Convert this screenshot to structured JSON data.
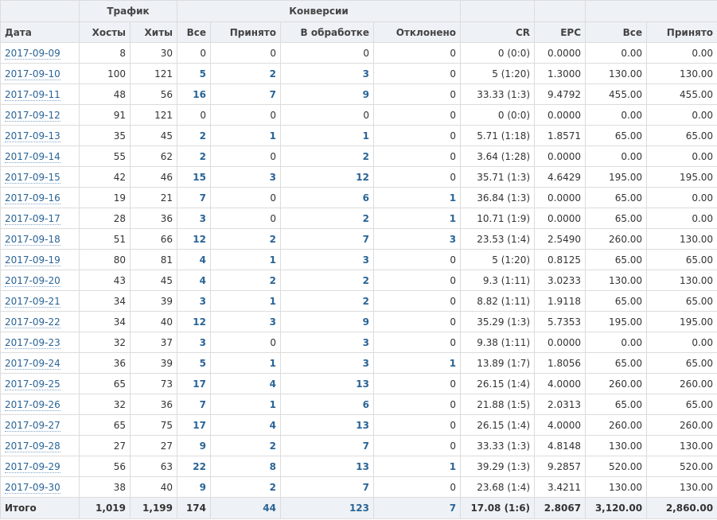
{
  "header": {
    "group_traffic": "Трафик",
    "group_conversions": "Конверсии",
    "col_date": "Дата",
    "col_hosts": "Хосты",
    "col_hits": "Хиты",
    "col_conv_all": "Все",
    "col_conv_accepted": "Принято",
    "col_conv_processing": "В обработке",
    "col_conv_rejected": "Отклонено",
    "col_cr": "CR",
    "col_epc": "EPC",
    "col_money_all": "Все",
    "col_money_accepted": "Принято"
  },
  "rows": [
    {
      "date": "2017-09-09",
      "hosts": "8",
      "hits": "30",
      "all": "0",
      "accepted": "0",
      "processing": "0",
      "rejected": "0",
      "cr": "0 (0:0)",
      "epc": "0.0000",
      "m_all": "0.00",
      "m_accepted": "0.00"
    },
    {
      "date": "2017-09-10",
      "hosts": "100",
      "hits": "121",
      "all": "5",
      "accepted": "2",
      "processing": "3",
      "rejected": "0",
      "cr": "5 (1:20)",
      "epc": "1.3000",
      "m_all": "130.00",
      "m_accepted": "130.00"
    },
    {
      "date": "2017-09-11",
      "hosts": "48",
      "hits": "56",
      "all": "16",
      "accepted": "7",
      "processing": "9",
      "rejected": "0",
      "cr": "33.33 (1:3)",
      "epc": "9.4792",
      "m_all": "455.00",
      "m_accepted": "455.00"
    },
    {
      "date": "2017-09-12",
      "hosts": "91",
      "hits": "121",
      "all": "0",
      "accepted": "0",
      "processing": "0",
      "rejected": "0",
      "cr": "0 (0:0)",
      "epc": "0.0000",
      "m_all": "0.00",
      "m_accepted": "0.00"
    },
    {
      "date": "2017-09-13",
      "hosts": "35",
      "hits": "45",
      "all": "2",
      "accepted": "1",
      "processing": "1",
      "rejected": "0",
      "cr": "5.71 (1:18)",
      "epc": "1.8571",
      "m_all": "65.00",
      "m_accepted": "65.00"
    },
    {
      "date": "2017-09-14",
      "hosts": "55",
      "hits": "62",
      "all": "2",
      "accepted": "0",
      "processing": "2",
      "rejected": "0",
      "cr": "3.64 (1:28)",
      "epc": "0.0000",
      "m_all": "0.00",
      "m_accepted": "0.00"
    },
    {
      "date": "2017-09-15",
      "hosts": "42",
      "hits": "46",
      "all": "15",
      "accepted": "3",
      "processing": "12",
      "rejected": "0",
      "cr": "35.71 (1:3)",
      "epc": "4.6429",
      "m_all": "195.00",
      "m_accepted": "195.00"
    },
    {
      "date": "2017-09-16",
      "hosts": "19",
      "hits": "21",
      "all": "7",
      "accepted": "0",
      "processing": "6",
      "rejected": "1",
      "cr": "36.84 (1:3)",
      "epc": "0.0000",
      "m_all": "65.00",
      "m_accepted": "0.00"
    },
    {
      "date": "2017-09-17",
      "hosts": "28",
      "hits": "36",
      "all": "3",
      "accepted": "0",
      "processing": "2",
      "rejected": "1",
      "cr": "10.71 (1:9)",
      "epc": "0.0000",
      "m_all": "65.00",
      "m_accepted": "0.00"
    },
    {
      "date": "2017-09-18",
      "hosts": "51",
      "hits": "66",
      "all": "12",
      "accepted": "2",
      "processing": "7",
      "rejected": "3",
      "cr": "23.53 (1:4)",
      "epc": "2.5490",
      "m_all": "260.00",
      "m_accepted": "130.00"
    },
    {
      "date": "2017-09-19",
      "hosts": "80",
      "hits": "81",
      "all": "4",
      "accepted": "1",
      "processing": "3",
      "rejected": "0",
      "cr": "5 (1:20)",
      "epc": "0.8125",
      "m_all": "65.00",
      "m_accepted": "65.00"
    },
    {
      "date": "2017-09-20",
      "hosts": "43",
      "hits": "45",
      "all": "4",
      "accepted": "2",
      "processing": "2",
      "rejected": "0",
      "cr": "9.3 (1:11)",
      "epc": "3.0233",
      "m_all": "130.00",
      "m_accepted": "130.00"
    },
    {
      "date": "2017-09-21",
      "hosts": "34",
      "hits": "39",
      "all": "3",
      "accepted": "1",
      "processing": "2",
      "rejected": "0",
      "cr": "8.82 (1:11)",
      "epc": "1.9118",
      "m_all": "65.00",
      "m_accepted": "65.00"
    },
    {
      "date": "2017-09-22",
      "hosts": "34",
      "hits": "40",
      "all": "12",
      "accepted": "3",
      "processing": "9",
      "rejected": "0",
      "cr": "35.29 (1:3)",
      "epc": "5.7353",
      "m_all": "195.00",
      "m_accepted": "195.00"
    },
    {
      "date": "2017-09-23",
      "hosts": "32",
      "hits": "37",
      "all": "3",
      "accepted": "0",
      "processing": "3",
      "rejected": "0",
      "cr": "9.38 (1:11)",
      "epc": "0.0000",
      "m_all": "0.00",
      "m_accepted": "0.00"
    },
    {
      "date": "2017-09-24",
      "hosts": "36",
      "hits": "39",
      "all": "5",
      "accepted": "1",
      "processing": "3",
      "rejected": "1",
      "cr": "13.89 (1:7)",
      "epc": "1.8056",
      "m_all": "65.00",
      "m_accepted": "65.00"
    },
    {
      "date": "2017-09-25",
      "hosts": "65",
      "hits": "73",
      "all": "17",
      "accepted": "4",
      "processing": "13",
      "rejected": "0",
      "cr": "26.15 (1:4)",
      "epc": "4.0000",
      "m_all": "260.00",
      "m_accepted": "260.00"
    },
    {
      "date": "2017-09-26",
      "hosts": "32",
      "hits": "36",
      "all": "7",
      "accepted": "1",
      "processing": "6",
      "rejected": "0",
      "cr": "21.88 (1:5)",
      "epc": "2.0313",
      "m_all": "65.00",
      "m_accepted": "65.00"
    },
    {
      "date": "2017-09-27",
      "hosts": "65",
      "hits": "75",
      "all": "17",
      "accepted": "4",
      "processing": "13",
      "rejected": "0",
      "cr": "26.15 (1:4)",
      "epc": "4.0000",
      "m_all": "260.00",
      "m_accepted": "260.00"
    },
    {
      "date": "2017-09-28",
      "hosts": "27",
      "hits": "27",
      "all": "9",
      "accepted": "2",
      "processing": "7",
      "rejected": "0",
      "cr": "33.33 (1:3)",
      "epc": "4.8148",
      "m_all": "130.00",
      "m_accepted": "130.00"
    },
    {
      "date": "2017-09-29",
      "hosts": "56",
      "hits": "63",
      "all": "22",
      "accepted": "8",
      "processing": "13",
      "rejected": "1",
      "cr": "39.29 (1:3)",
      "epc": "9.2857",
      "m_all": "520.00",
      "m_accepted": "520.00"
    },
    {
      "date": "2017-09-30",
      "hosts": "38",
      "hits": "40",
      "all": "9",
      "accepted": "2",
      "processing": "7",
      "rejected": "0",
      "cr": "23.68 (1:4)",
      "epc": "3.4211",
      "m_all": "130.00",
      "m_accepted": "130.00"
    }
  ],
  "totals": {
    "label": "Итого",
    "hosts": "1,019",
    "hits": "1,199",
    "all": "174",
    "accepted": "44",
    "processing": "123",
    "rejected": "7",
    "cr": "17.08 (1:6)",
    "epc": "2.8067",
    "m_all": "3,120.00",
    "m_accepted": "2,860.00"
  },
  "colors": {
    "link": "#2a6496",
    "header_bg": "#eef2f6",
    "border": "#dcdcdc"
  }
}
